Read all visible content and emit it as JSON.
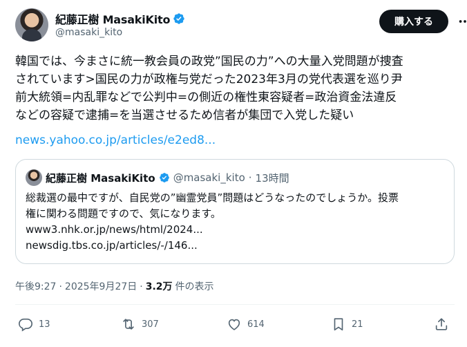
{
  "author": {
    "display_name": "紀藤正樹 MasakiKito",
    "handle": "@masaki_kito"
  },
  "buy_button_label": "購入する",
  "tweet": {
    "text": "韓国では、今まさに統一教会員の政党”国民の力”への大量入党問題が捜査\nされています>国民の力が政権与党だった2023年3月の党代表選を巡り尹\n前大統領=内乱罪などで公判中=の側近の権性東容疑者=政治資金法違反\nなどの容疑で逮捕=を当選させるため信者が集団で入党した疑い",
    "link": "news.yahoo.co.jp/articles/e2ed8..."
  },
  "quote": {
    "display_name": "紀藤正樹 MasakiKito",
    "handle": "@masaki_kito",
    "dot": "·",
    "time": "13時間",
    "lines": [
      "総裁選の最中ですが、自民党の”幽霊党員”問題はどうなったのでしょうか。投票",
      "権に関わる問題ですので、気になります。",
      "www3.nhk.or.jp/news/html/2024...",
      "newsdig.tbs.co.jp/articles/-/146..."
    ]
  },
  "meta": {
    "time": "午後9:27",
    "separator": "·",
    "date": "2025年9月27日",
    "separator2": "·",
    "views_count": "3.2万",
    "views_label": "件の表示"
  },
  "actions": {
    "replies": "13",
    "reposts": "307",
    "likes": "614",
    "bookmarks": "21"
  },
  "colors": {
    "verified": "#1d9bf0",
    "link": "#1d9bf0",
    "button_bg": "#0f1419"
  }
}
